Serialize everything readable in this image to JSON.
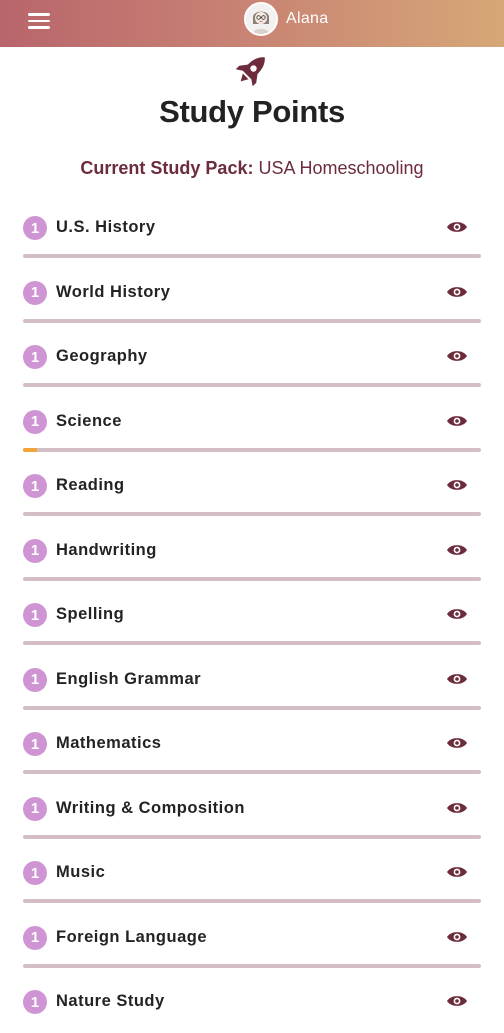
{
  "header": {
    "user_name": "Alana",
    "gradient": [
      "#b8656b",
      "#d6a777"
    ]
  },
  "page": {
    "title": "Study Points",
    "pack_label": "Current Study Pack:",
    "pack_name": "USA Homeschooling",
    "icon": "rocket-icon"
  },
  "colors": {
    "badge": "#cf94d3",
    "accent": "#6c2c3c",
    "progress_track": "#d3bec4",
    "progress_fill": "#f0a43a"
  },
  "subjects": [
    {
      "points": "1",
      "name": "U.S. History",
      "progress": 0
    },
    {
      "points": "1",
      "name": "World History",
      "progress": 0
    },
    {
      "points": "1",
      "name": "Geography",
      "progress": 0
    },
    {
      "points": "1",
      "name": "Science",
      "progress": 0.03
    },
    {
      "points": "1",
      "name": "Reading",
      "progress": 0
    },
    {
      "points": "1",
      "name": "Handwriting",
      "progress": 0
    },
    {
      "points": "1",
      "name": "Spelling",
      "progress": 0
    },
    {
      "points": "1",
      "name": "English Grammar",
      "progress": 0
    },
    {
      "points": "1",
      "name": "Mathematics",
      "progress": 0
    },
    {
      "points": "1",
      "name": "Writing & Composition",
      "progress": 0
    },
    {
      "points": "1",
      "name": "Music",
      "progress": 0
    },
    {
      "points": "1",
      "name": "Foreign Language",
      "progress": 0
    },
    {
      "points": "1",
      "name": "Nature Study",
      "progress": 0
    }
  ]
}
